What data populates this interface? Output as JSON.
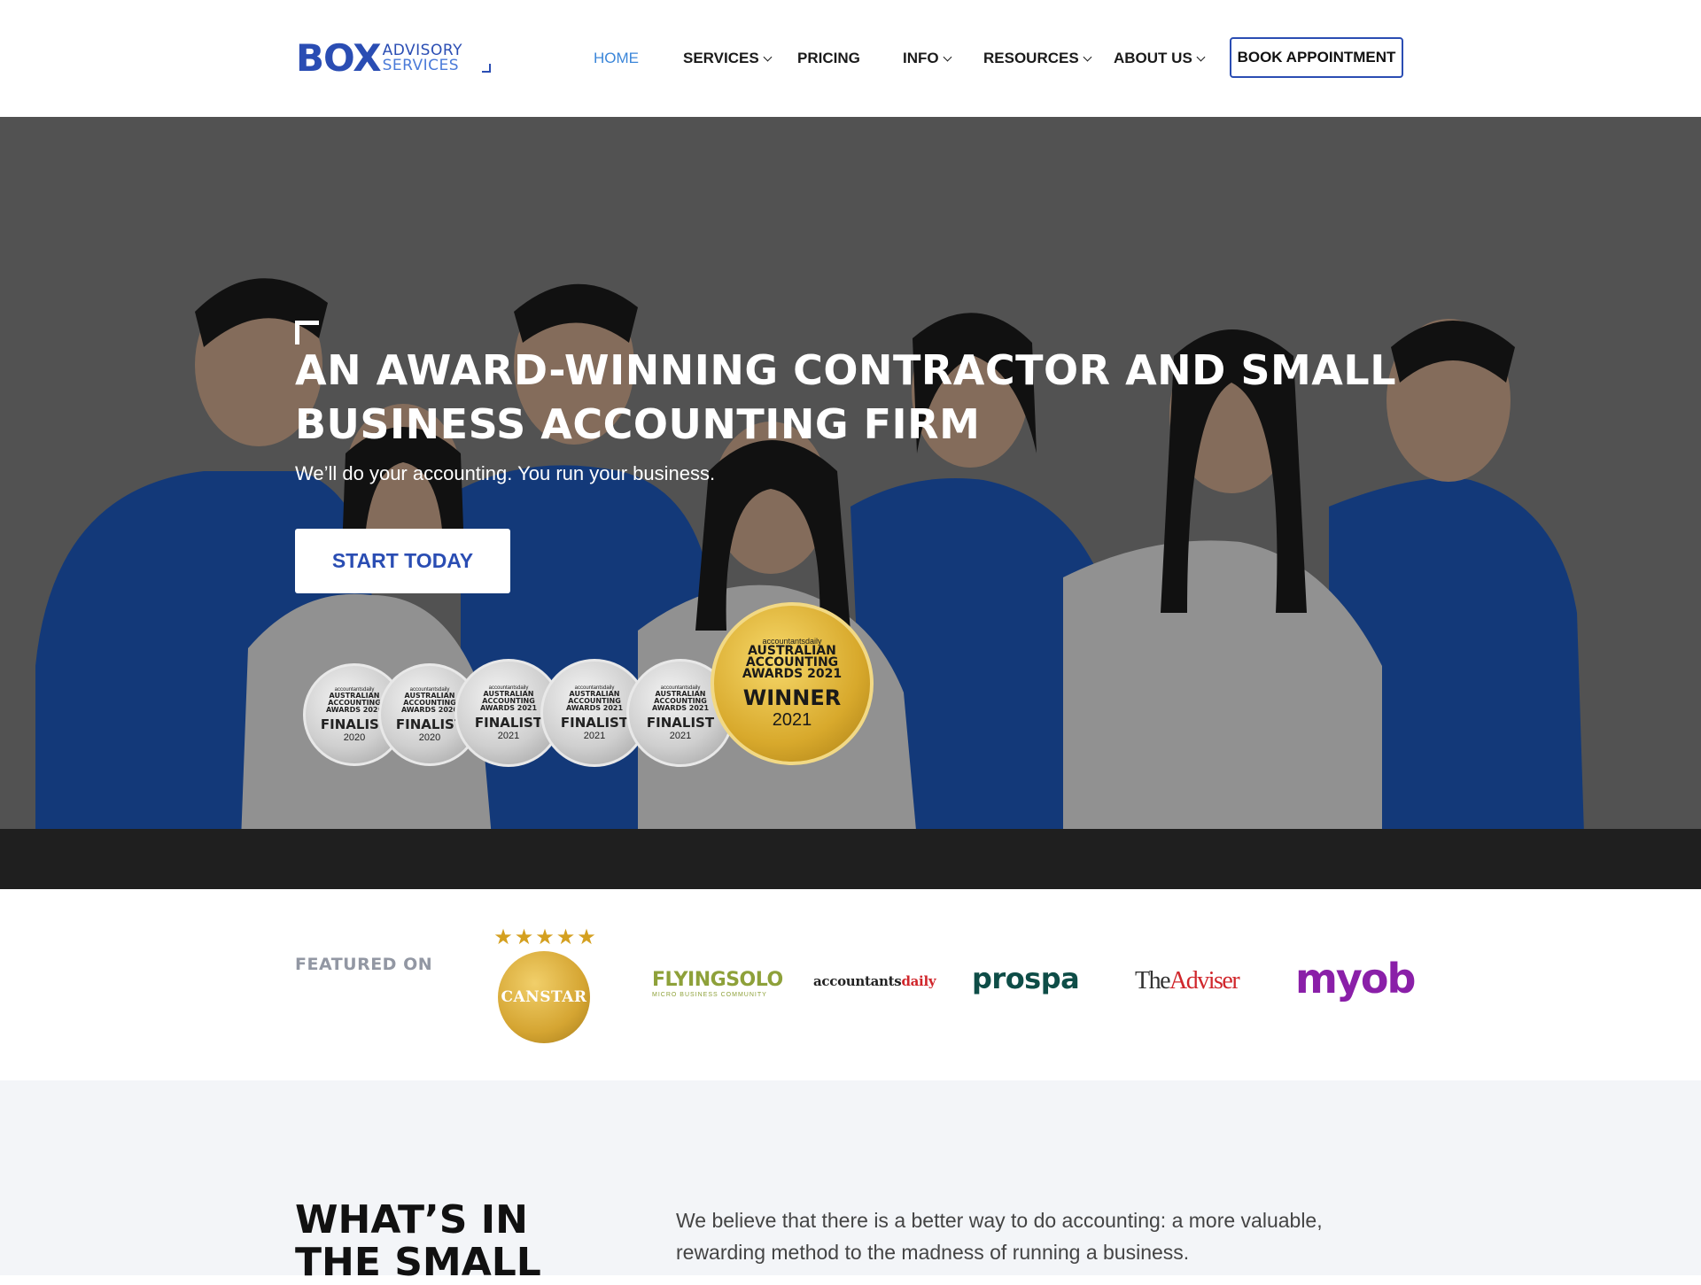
{
  "header": {
    "logo": {
      "main": "BOX",
      "line1": "ADVISORY",
      "line2": "SERVICES"
    },
    "nav": [
      {
        "label": "HOME",
        "active": true,
        "dropdown": false
      },
      {
        "label": "SERVICES",
        "active": false,
        "dropdown": true
      },
      {
        "label": "PRICING",
        "active": false,
        "dropdown": false
      },
      {
        "label": "INFO",
        "active": false,
        "dropdown": true
      },
      {
        "label": "RESOURCES",
        "active": false,
        "dropdown": true
      },
      {
        "label": "ABOUT US",
        "active": false,
        "dropdown": true
      }
    ],
    "book_button": "BOOK APPOINTMENT"
  },
  "hero": {
    "title": "AN AWARD-WINNING CONTRACTOR AND SMALL BUSINESS ACCOUNTING FIRM",
    "subtitle": "We’ll do your accounting. You run your business.",
    "cta": "START TODAY",
    "badges": [
      {
        "brand": "accountantsdaily",
        "awards_line1": "AUSTRALIAN",
        "awards_line2": "ACCOUNTING",
        "awards_line3": "AWARDS 2020",
        "status": "FINALIST",
        "year": "2020"
      },
      {
        "brand": "accountantsdaily",
        "awards_line1": "AUSTRALIAN",
        "awards_line2": "ACCOUNTING",
        "awards_line3": "AWARDS 2020",
        "status": "FINALIST",
        "year": "2020"
      },
      {
        "brand": "accountantsdaily",
        "awards_line1": "AUSTRALIAN",
        "awards_line2": "ACCOUNTING",
        "awards_line3": "AWARDS 2021",
        "status": "FINALIST",
        "year": "2021"
      },
      {
        "brand": "accountantsdaily",
        "awards_line1": "AUSTRALIAN",
        "awards_line2": "ACCOUNTING",
        "awards_line3": "AWARDS 2021",
        "status": "FINALIST",
        "year": "2021"
      },
      {
        "brand": "accountantsdaily",
        "awards_line1": "AUSTRALIAN",
        "awards_line2": "ACCOUNTING",
        "awards_line3": "AWARDS 2021",
        "status": "FINALIST",
        "year": "2021"
      }
    ],
    "winner_badge": {
      "brand": "accountantsdaily",
      "awards_line1": "AUSTRALIAN",
      "awards_line2": "ACCOUNTING",
      "awards_line3": "AWARDS 2021",
      "status": "WINNER",
      "year": "2021"
    }
  },
  "featured": {
    "label": "FEATURED ON",
    "logos": {
      "canstar": "CANSTAR",
      "flyingsolo": "FLYINGSOLO",
      "flyingsolo_sub": "MICRO BUSINESS COMMUNITY",
      "accountantsdaily_a": "accountants",
      "accountantsdaily_b": "daily",
      "prospa": "prospa",
      "adviser_a": "The",
      "adviser_b": "Adviser",
      "myob": "myob"
    }
  },
  "whats": {
    "title": "WHAT’S IN THE SMALL",
    "text": "We believe that there is a better way to do accounting: a more valuable, rewarding method to the madness of running a business."
  },
  "colors": {
    "brand_blue": "#2a4db3",
    "nav_active": "#3b86d9",
    "shirt_blue": "#1e56b8",
    "gold": "#d8a92c",
    "myob_purple": "#8a1fa8",
    "prospa_green": "#0e4d47"
  }
}
